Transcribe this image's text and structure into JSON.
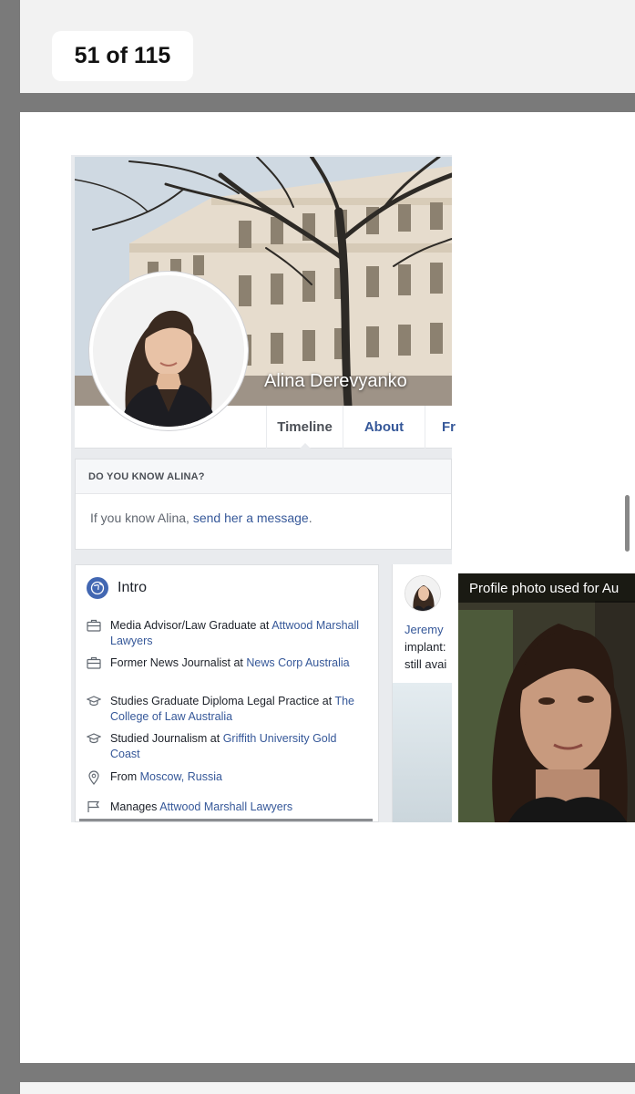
{
  "counter": {
    "label": "51 of 115"
  },
  "profile": {
    "name": "Alina Derevyanko",
    "tabs": [
      {
        "label": "Timeline"
      },
      {
        "label": "About"
      },
      {
        "label": "Fr"
      }
    ]
  },
  "know_card": {
    "heading": "DO YOU KNOW ALINA?",
    "text_prefix": "If you know Alina, ",
    "link_text": "send her a message",
    "text_suffix": "."
  },
  "intro": {
    "title": "Intro",
    "items": [
      {
        "icon": "briefcase-icon",
        "text": "Media Advisor/Law Graduate at ",
        "link": "Attwood Marshall Lawyers"
      },
      {
        "icon": "briefcase-icon",
        "text": "Former News Journalist at ",
        "link": "News Corp Australia"
      },
      {
        "icon": "graduation-cap-icon",
        "text": "Studies Graduate Diploma Legal Practice at ",
        "link": "The College of Law Australia"
      },
      {
        "icon": "graduation-cap-icon",
        "text": "Studied Journalism at ",
        "link": "Griffith University Gold Coast"
      },
      {
        "icon": "location-pin-icon",
        "text": "From ",
        "link": "Moscow, Russia"
      },
      {
        "icon": "flag-icon",
        "text": "Manages ",
        "link": "Attwood Marshall Lawyers"
      }
    ]
  },
  "post": {
    "author_fragment": "Jeremy",
    "line2": "implant:",
    "line3": "still avai"
  },
  "photo_panel": {
    "caption": "Profile photo used for Au"
  },
  "colors": {
    "facebook_blue": "#4267b2",
    "link_blue": "#365899",
    "frame_gray": "#7a7a7a"
  }
}
